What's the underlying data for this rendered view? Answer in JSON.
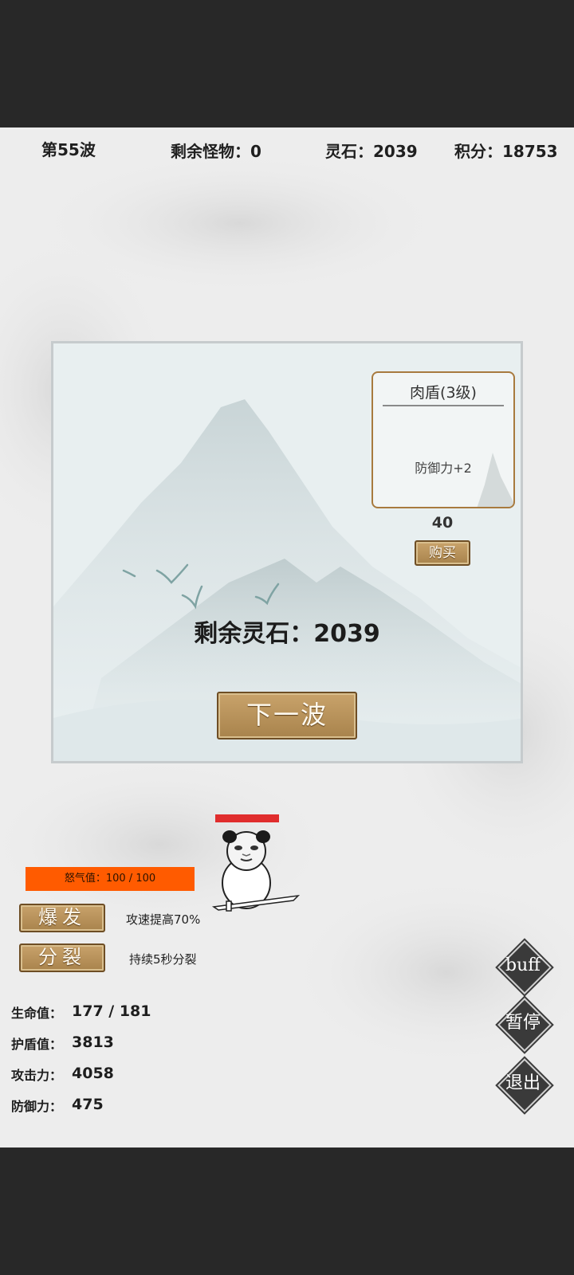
{
  "hud": {
    "wave": "第55波",
    "monsters_left": "剩余怪物：0",
    "spirit_stones": "灵石：2039",
    "score": "积分：18753"
  },
  "shop": {
    "item": {
      "title": "肉盾(3级)",
      "effect": "防御力+2",
      "price": "40",
      "buy_label": "购买"
    },
    "remaining_stones": "剩余灵石：2039",
    "next_wave_label": "下一波"
  },
  "player": {
    "hp_fraction": 0.98
  },
  "rage": {
    "label": "怒气值：100 / 100",
    "value": 100,
    "max": 100
  },
  "skills": [
    {
      "label": "爆发",
      "desc": "攻速提高70%"
    },
    {
      "label": "分裂",
      "desc": "持续5秒分裂"
    }
  ],
  "stats": [
    {
      "label": "生命值：",
      "value": "177 / 181"
    },
    {
      "label": "护盾值：",
      "value": "3813"
    },
    {
      "label": "攻击力：",
      "value": "4058"
    },
    {
      "label": "防御力：",
      "value": "475"
    }
  ],
  "side_buttons": {
    "buff": "buff",
    "pause": "暂停",
    "exit": "退出"
  },
  "colors": {
    "rage_bar": "#ff5b00",
    "hp_bar": "#e02d2d",
    "wood_button": "#b89158"
  }
}
